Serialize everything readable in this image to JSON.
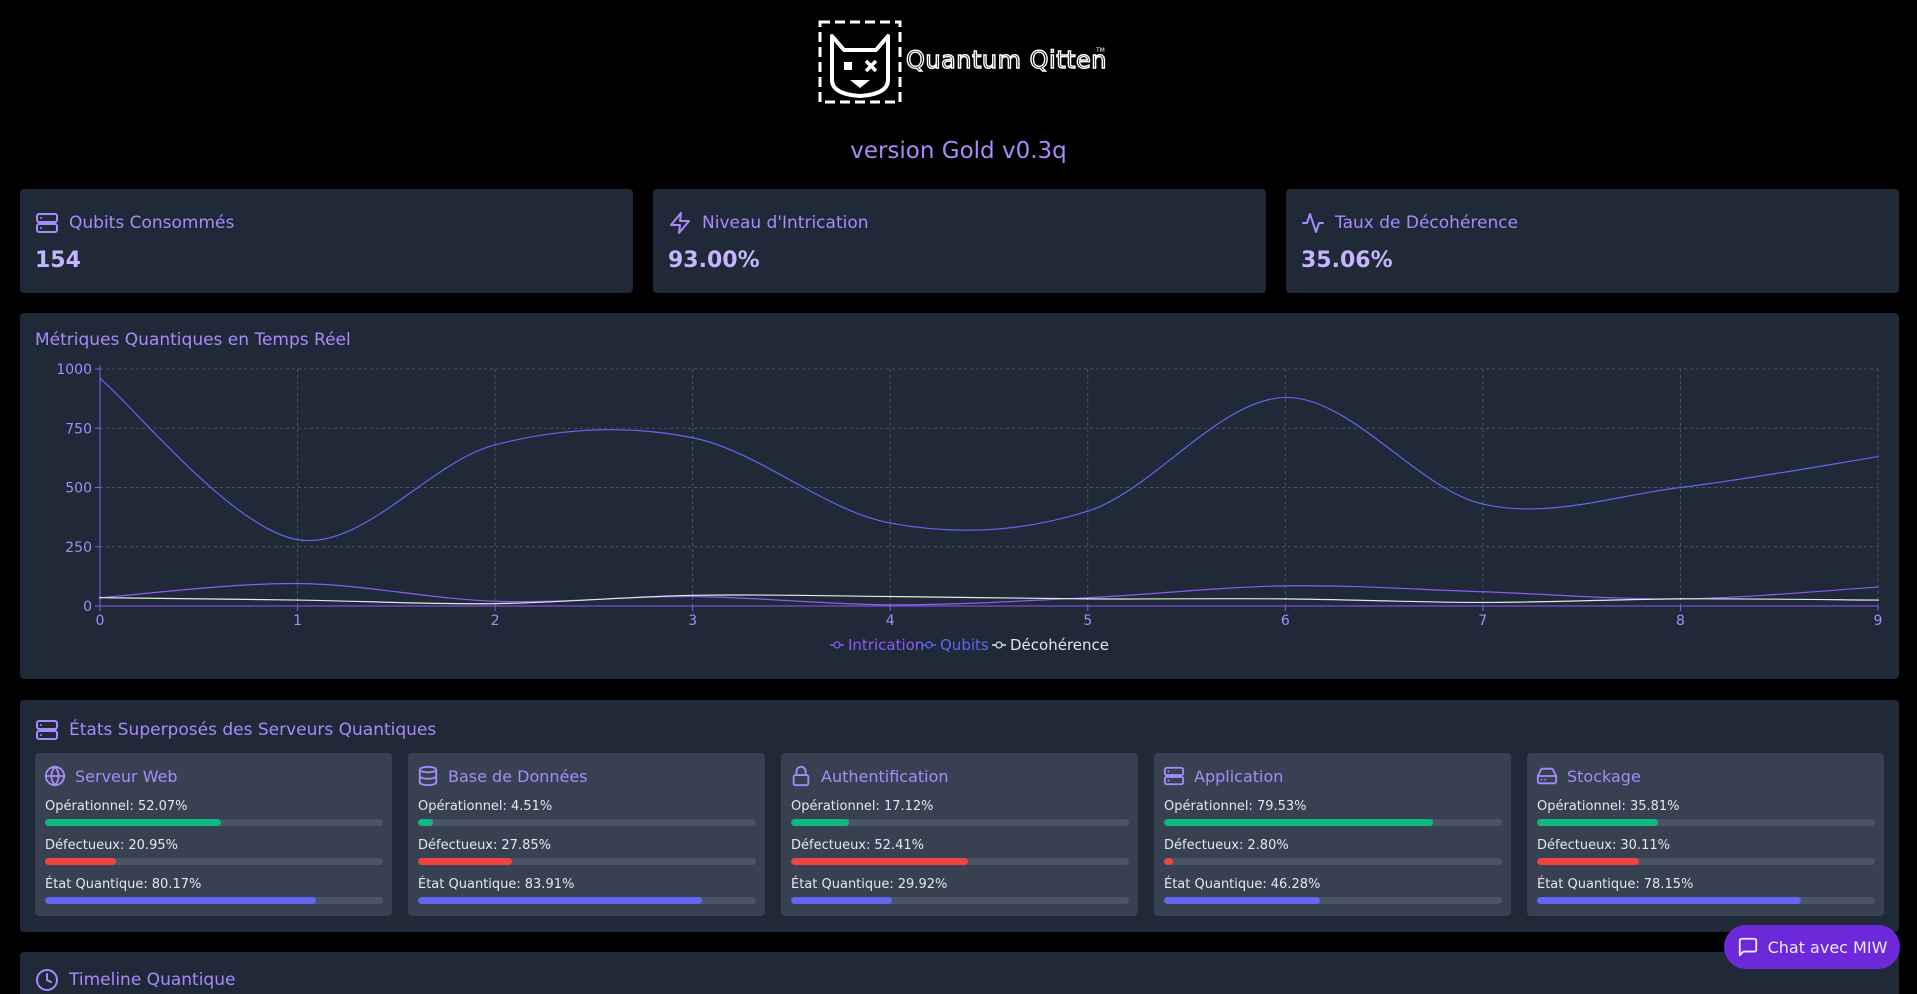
{
  "header": {
    "logo_alt": "Quantum Qitten",
    "version": "version Gold v0.3q"
  },
  "stats": [
    {
      "label": "Qubits Consommés",
      "value": "154",
      "icon": "server-icon"
    },
    {
      "label": "Niveau d'Intrication",
      "value": "93.00%",
      "icon": "lightning-icon"
    },
    {
      "label": "Taux de Décohérence",
      "value": "35.06%",
      "icon": "activity-icon"
    }
  ],
  "chart_data": {
    "type": "line",
    "title": "Métriques Quantiques en Temps Réel",
    "x": [
      0,
      1,
      2,
      3,
      4,
      5,
      6,
      7,
      8,
      9
    ],
    "ylim": [
      0,
      1000
    ],
    "yticks": [
      0,
      250,
      500,
      750,
      1000
    ],
    "grid": true,
    "legend_position": "bottom-center",
    "series": [
      {
        "name": "Intrication",
        "color": "#8b5cf6",
        "values": [
          35,
          95,
          20,
          40,
          5,
          35,
          85,
          60,
          30,
          80
        ]
      },
      {
        "name": "Qubits",
        "color": "#6366f1",
        "values": [
          960,
          280,
          680,
          710,
          350,
          400,
          880,
          430,
          500,
          630
        ]
      },
      {
        "name": "Décohérence",
        "color": "#e5e7eb",
        "values": [
          35,
          25,
          10,
          45,
          40,
          30,
          30,
          15,
          30,
          25
        ]
      }
    ]
  },
  "servers": {
    "title": "États Superposés des Serveurs Quantiques",
    "items": [
      {
        "name": "Serveur Web",
        "icon": "globe-icon",
        "op_label": "Opérationnel:",
        "op": "52.07%",
        "op_frac": 0.5207,
        "def_label": "Défectueux:",
        "def": "20.95%",
        "def_frac": 0.2095,
        "q_label": "État Quantique:",
        "q": "80.17%",
        "q_frac": 0.8017
      },
      {
        "name": "Base de Données",
        "icon": "database-icon",
        "op_label": "Opérationnel:",
        "op": "4.51%",
        "op_frac": 0.0451,
        "def_label": "Défectueux:",
        "def": "27.85%",
        "def_frac": 0.2785,
        "q_label": "État Quantique:",
        "q": "83.91%",
        "q_frac": 0.8391
      },
      {
        "name": "Authentification",
        "icon": "lock-icon",
        "op_label": "Opérationnel:",
        "op": "17.12%",
        "op_frac": 0.1712,
        "def_label": "Défectueux:",
        "def": "52.41%",
        "def_frac": 0.5241,
        "q_label": "État Quantique:",
        "q": "29.92%",
        "q_frac": 0.2992
      },
      {
        "name": "Application",
        "icon": "server-icon",
        "op_label": "Opérationnel:",
        "op": "79.53%",
        "op_frac": 0.7953,
        "def_label": "Défectueux:",
        "def": "2.80%",
        "def_frac": 0.028,
        "q_label": "État Quantique:",
        "q": "46.28%",
        "q_frac": 0.4628
      },
      {
        "name": "Stockage",
        "icon": "harddrive-icon",
        "op_label": "Opérationnel:",
        "op": "35.81%",
        "op_frac": 0.3581,
        "def_label": "Défectueux:",
        "def": "30.11%",
        "def_frac": 0.3011,
        "q_label": "État Quantique:",
        "q": "78.15%",
        "q_frac": 0.7815
      }
    ]
  },
  "timeline": {
    "title": "Timeline Quantique"
  },
  "chat": {
    "label": "Chat avec MIW"
  }
}
